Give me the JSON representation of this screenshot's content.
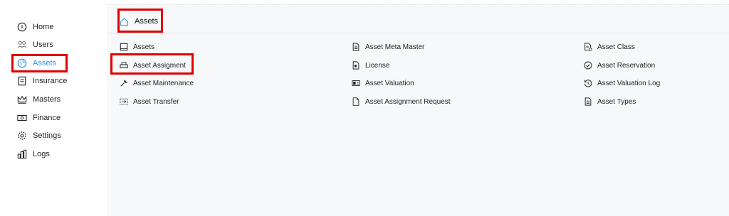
{
  "sidebar": {
    "items": [
      {
        "label": "Home",
        "icon": "home-icon"
      },
      {
        "label": "Users",
        "icon": "users-icon"
      },
      {
        "label": "Assets",
        "icon": "assets-icon",
        "active": true
      },
      {
        "label": "Insurance",
        "icon": "insurance-icon"
      },
      {
        "label": "Masters",
        "icon": "crown-icon"
      },
      {
        "label": "Finance",
        "icon": "money-icon"
      },
      {
        "label": "Settings",
        "icon": "gear-icon"
      },
      {
        "label": "Logs",
        "icon": "bar-chart-icon"
      }
    ]
  },
  "breadcrumb": {
    "label": "Assets",
    "icon": "home-icon"
  },
  "links": {
    "col1": [
      {
        "label": "Assets",
        "icon": "box-icon"
      },
      {
        "label": "Asset Assigment",
        "icon": "printer-icon"
      },
      {
        "label": "Asset Maintenance",
        "icon": "wrench-icon"
      },
      {
        "label": "Asset Transfer",
        "icon": "transfer-icon"
      }
    ],
    "col2": [
      {
        "label": "Asset Meta Master",
        "icon": "document-icon"
      },
      {
        "label": "License",
        "icon": "license-icon"
      },
      {
        "label": "Asset Valuation",
        "icon": "valuation-icon"
      },
      {
        "label": "Asset Assignment Request",
        "icon": "file-icon"
      }
    ],
    "col3": [
      {
        "label": "Asset Class",
        "icon": "class-icon"
      },
      {
        "label": "Asset Reservation",
        "icon": "check-circle-icon"
      },
      {
        "label": "Asset Valuation Log",
        "icon": "history-icon"
      },
      {
        "label": "Asset Types",
        "icon": "list-doc-icon"
      }
    ]
  },
  "colors": {
    "accent": "#2f8fd6",
    "highlight": "#e00000"
  }
}
